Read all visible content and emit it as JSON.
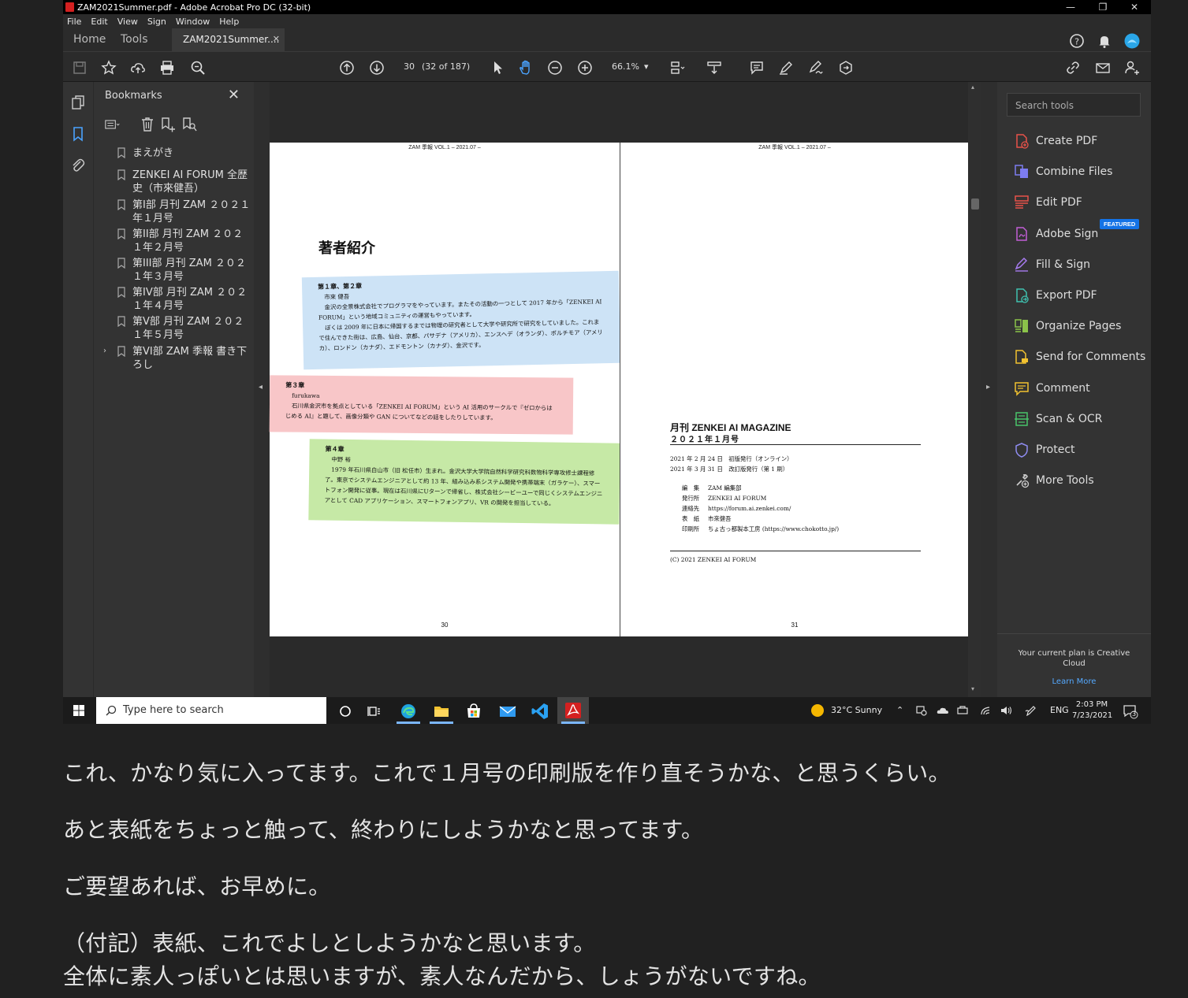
{
  "window": {
    "title": "ZAM2021Summer.pdf - Adobe Acrobat Pro DC (32-bit)",
    "controls": {
      "minimize": "—",
      "restore": "❐",
      "close": "✕"
    }
  },
  "menu": [
    "File",
    "Edit",
    "View",
    "Sign",
    "Window",
    "Help"
  ],
  "tabs": {
    "home": "Home",
    "tools": "Tools",
    "document": "ZAM2021Summer...."
  },
  "toolbar": {
    "page_number": "30",
    "page_of": "(32 of 187)",
    "zoom": "66.1%"
  },
  "bookmarks": {
    "title": "Bookmarks",
    "items": [
      "まえがき",
      "ZENKEI AI FORUM 全歴史（市來健吾）",
      "第I部 月刊 ZAM ２０２１年１月号",
      "第II部 月刊 ZAM ２０２１年２月号",
      "第III部 月刊 ZAM ２０２１年３月号",
      "第IV部 月刊 ZAM ２０２１年４月号",
      "第V部 月刊 ZAM ２０２１年５月号",
      "第VI部 ZAM 季報 書き下ろし"
    ],
    "expander": "›"
  },
  "page_left": {
    "running_head": "ZAM 季報 VOL.1 – 2021.07 –",
    "heading": "著者紹介",
    "blue": {
      "chapter": "第１章、第２章",
      "name": "市來 健吾",
      "body": [
        "金沢の全景株式会社でプログラマをやっています。またその活動の一つとして 2017 年から「ZENKEI AI FORUM」という地域コミュニティの運営もやっています。",
        "ぼくは 2009 年に日本に帰国するまでは物理の研究者として大学や研究所で研究をしていました。これまで住んできた街は、広島、仙台、京都、パサデナ（アメリカ）、エンスヘデ（オランダ）、ポルチモア（アメリカ）、ロンドン（カナダ）、エドモントン（カナダ）、金沢です。"
      ]
    },
    "pink": {
      "chapter": "第３章",
      "name": "furukawa",
      "body": [
        "石川県金沢市を拠点としている「ZENKEI AI FORUM」という AI 活用のサークルで『ゼロからはじめる AI』と題して、画像分類や GAN についてなどの話をしたりしています。"
      ]
    },
    "green": {
      "chapter": "第４章",
      "name": "中野 裕",
      "body": [
        "1979 年石川県白山市（旧 松任市）生まれ。金沢大学大学院自然科学研究科数物科学専攻修士課程修了。東京でシステムエンジニアとして約 13 年、組み込み系システム開発や携帯端末（ガラケー）、スマートフォン開発に従事。現在は石川県にUターンで帰省し、株式会社シービーユーで同じくシステムエンジニアとして CAD アプリケーション、スマートフォンアプリ、VR の開発を担当している。"
      ]
    },
    "page_no": "30"
  },
  "page_right": {
    "running_head": "ZAM 季報 VOL.1 – 2021.07 –",
    "magazine_title": "月刊 ZENKEI AI MAGAZINE",
    "issue": "２０２１年１月号",
    "dates": [
      "2021 年 2 月 24 日　初版発行（オンライン）",
      "2021 年 3 月 31 日　改訂版発行（第 1 刷）"
    ],
    "credits": [
      {
        "label": "編　集",
        "value": "ZAM 編集部"
      },
      {
        "label": "発行所",
        "value": "ZENKEI AI FORUM"
      },
      {
        "label": "連絡先",
        "value": "https://forum.ai.zenkei.com/"
      },
      {
        "label": "表　紙",
        "value": "市來健吾"
      },
      {
        "label": "印刷所",
        "value": "ちょ古っ都製本工房 (https://www.chokotto.jp/)"
      }
    ],
    "copyright": "(C) 2021 ZENKEI AI FORUM",
    "page_no": "31"
  },
  "tools_pane": {
    "search_placeholder": "Search tools",
    "featured_badge": "FEATURED",
    "items": [
      {
        "label": "Create PDF",
        "icon": "create-pdf-icon",
        "color": "#e8524a"
      },
      {
        "label": "Combine Files",
        "icon": "combine-files-icon",
        "color": "#7d7cf0"
      },
      {
        "label": "Edit PDF",
        "icon": "edit-pdf-icon",
        "color": "#e8524a"
      },
      {
        "label": "Adobe Sign",
        "icon": "adobe-sign-icon",
        "color": "#c25ed6"
      },
      {
        "label": "Fill & Sign",
        "icon": "fill-sign-icon",
        "color": "#a77bf0"
      },
      {
        "label": "Export PDF",
        "icon": "export-pdf-icon",
        "color": "#3fc1b0"
      },
      {
        "label": "Organize Pages",
        "icon": "organize-pages-icon",
        "color": "#8bc34a"
      },
      {
        "label": "Send for Comments",
        "icon": "send-for-comments-icon",
        "color": "#f2c230"
      },
      {
        "label": "Comment",
        "icon": "comment-icon",
        "color": "#f2c230"
      },
      {
        "label": "Scan & OCR",
        "icon": "scan-ocr-icon",
        "color": "#49c46a"
      },
      {
        "label": "Protect",
        "icon": "protect-icon",
        "color": "#8f8cf0"
      },
      {
        "label": "More Tools",
        "icon": "more-tools-icon",
        "color": "#cccccc"
      }
    ],
    "plan_text": "Your current plan is Creative Cloud",
    "learn_more": "Learn More"
  },
  "taskbar": {
    "search_placeholder": "Type here to search",
    "weather": "32°C  Sunny",
    "language": "ENG",
    "time": "2:03 PM",
    "date": "7/23/2021",
    "notifications": "3"
  },
  "caption": [
    "これ、かなり気に入ってます。これで１月号の印刷版を作り直そうかな、と思うくらい。",
    "あと表紙をちょっと触って、終わりにしようかなと思ってます。",
    "ご要望あれば、お早めに。",
    "（付記）表紙、これでよしとしようかなと思います。",
    "全体に素人っぽいとは思いますが、素人なんだから、しょうがないですね。"
  ]
}
